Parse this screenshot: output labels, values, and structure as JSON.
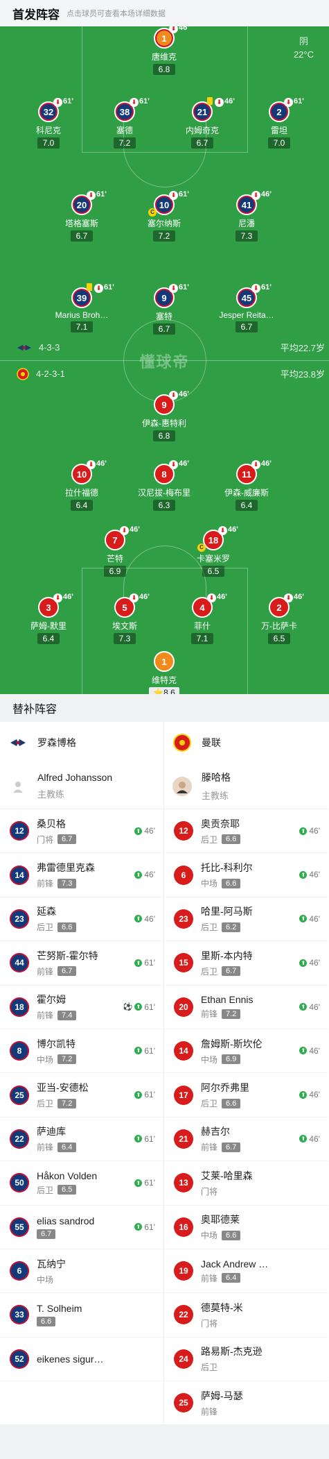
{
  "header": {
    "title": "首发阵容",
    "subtitle": "点击球员可查看本场详细数据"
  },
  "weather": {
    "condition": "阴",
    "temperature": "22°C"
  },
  "watermark": "懂球帝",
  "away_team": {
    "formation": "4-3-3",
    "avg_age": "平均22.7岁"
  },
  "home_team": {
    "formation": "4-2-3-1",
    "avg_age": "平均23.8岁"
  },
  "away_lineup": [
    {
      "num": "1",
      "name": "唐维克",
      "rating": "6.8",
      "sub_min": "46'",
      "gk": true
    },
    {
      "num": "32",
      "name": "科尼克",
      "rating": "7.0",
      "sub_min": "61'"
    },
    {
      "num": "38",
      "name": "塞德",
      "rating": "7.2",
      "sub_min": "61'"
    },
    {
      "num": "21",
      "name": "内姆奇克",
      "rating": "6.7",
      "sub_min": "46'",
      "yellow": true
    },
    {
      "num": "2",
      "name": "雷坦",
      "rating": "7.0",
      "sub_min": "61'"
    },
    {
      "num": "20",
      "name": "塔格塞斯",
      "rating": "6.7",
      "sub_min": "61'"
    },
    {
      "num": "10",
      "name": "塞尔纳斯",
      "rating": "7.2",
      "sub_min": "61'",
      "captain": true
    },
    {
      "num": "41",
      "name": "尼潘",
      "rating": "7.3",
      "sub_min": "46'"
    },
    {
      "num": "39",
      "name": "Marius Broh…",
      "rating": "7.1",
      "sub_min": "61'",
      "yellow": true
    },
    {
      "num": "9",
      "name": "塞特",
      "rating": "6.7",
      "sub_min": "61'"
    },
    {
      "num": "45",
      "name": "Jesper Reita…",
      "rating": "6.7",
      "sub_min": "61'"
    }
  ],
  "home_lineup": [
    {
      "num": "9",
      "name": "伊森-惠特利",
      "rating": "6.8",
      "sub_min": "46'"
    },
    {
      "num": "10",
      "name": "拉什福德",
      "rating": "6.4",
      "sub_min": "46'"
    },
    {
      "num": "8",
      "name": "汉尼拔-梅布里",
      "rating": "6.3",
      "sub_min": "46'"
    },
    {
      "num": "11",
      "name": "伊森-威廉斯",
      "rating": "6.4",
      "sub_min": "46'"
    },
    {
      "num": "7",
      "name": "芒特",
      "rating": "6.9",
      "sub_min": "46'"
    },
    {
      "num": "18",
      "name": "卡塞米罗",
      "rating": "6.5",
      "sub_min": "46'",
      "captain": true
    },
    {
      "num": "3",
      "name": "萨姆-默里",
      "rating": "6.4",
      "sub_min": "46'"
    },
    {
      "num": "5",
      "name": "埃文斯",
      "rating": "7.3",
      "sub_min": "46'"
    },
    {
      "num": "4",
      "name": "菲什",
      "rating": "7.1",
      "sub_min": "46'"
    },
    {
      "num": "2",
      "name": "万-比萨卡",
      "rating": "6.5",
      "sub_min": "46'"
    },
    {
      "num": "1",
      "name": "维特克",
      "rating": "8.6",
      "star": true,
      "gk": true
    }
  ],
  "subs_title": "替补阵容",
  "left_team": {
    "name": "罗森博格",
    "coach": "Alfred Johansson",
    "coach_role": "主教练",
    "players": [
      {
        "num": "12",
        "name": "桑贝格",
        "pos": "门将",
        "rating": "6.7",
        "in": "46'"
      },
      {
        "num": "14",
        "name": "弗雷德里克森",
        "pos": "前锋",
        "rating": "7.3",
        "in": "46'"
      },
      {
        "num": "23",
        "name": "延森",
        "pos": "后卫",
        "rating": "6.6",
        "in": "46'"
      },
      {
        "num": "44",
        "name": "芒努斯-霍尔特",
        "pos": "前锋",
        "rating": "6.7",
        "in": "61'"
      },
      {
        "num": "18",
        "name": "霍尔姆",
        "pos": "前锋",
        "rating": "7.4",
        "in": "61'",
        "goal": true
      },
      {
        "num": "8",
        "name": "博尔凯特",
        "pos": "中场",
        "rating": "7.2",
        "in": "61'"
      },
      {
        "num": "25",
        "name": "亚当-安德松",
        "pos": "后卫",
        "rating": "7.2",
        "in": "61'"
      },
      {
        "num": "22",
        "name": "萨迪库",
        "pos": "前锋",
        "rating": "6.4",
        "in": "61'"
      },
      {
        "num": "50",
        "name": "Håkon Volden",
        "pos": "后卫",
        "rating": "6.5",
        "in": "61'"
      },
      {
        "num": "55",
        "name": "elias sandrod",
        "pos": "",
        "rating": "6.7",
        "in": "61'"
      },
      {
        "num": "6",
        "name": "瓦纳宁",
        "pos": "中场",
        "rating": "",
        "in": ""
      },
      {
        "num": "33",
        "name": "T. Solheim",
        "pos": "",
        "rating": "6.6",
        "in": ""
      },
      {
        "num": "52",
        "name": "eikenes sigur…",
        "pos": "",
        "rating": "",
        "in": ""
      }
    ]
  },
  "right_team": {
    "name": "曼联",
    "coach": "滕哈格",
    "coach_role": "主教练",
    "players": [
      {
        "num": "12",
        "name": "奥贡奈耶",
        "pos": "后卫",
        "rating": "6.6",
        "in": "46'"
      },
      {
        "num": "6",
        "name": "托比-科利尔",
        "pos": "中场",
        "rating": "6.6",
        "in": "46'"
      },
      {
        "num": "23",
        "name": "哈里-阿马斯",
        "pos": "后卫",
        "rating": "6.2",
        "in": "46'"
      },
      {
        "num": "15",
        "name": "里斯-本内特",
        "pos": "后卫",
        "rating": "6.7",
        "in": "46'"
      },
      {
        "num": "20",
        "name": "Ethan Ennis",
        "pos": "前锋",
        "rating": "7.2",
        "in": "46'"
      },
      {
        "num": "14",
        "name": "詹姆斯-斯坎伦",
        "pos": "中场",
        "rating": "6.9",
        "in": "46'"
      },
      {
        "num": "17",
        "name": "阿尔乔弗里",
        "pos": "后卫",
        "rating": "6.6",
        "in": "46'"
      },
      {
        "num": "21",
        "name": "赫吉尔",
        "pos": "前锋",
        "rating": "6.7",
        "in": "46'"
      },
      {
        "num": "13",
        "name": "艾莱-哈里森",
        "pos": "门将",
        "rating": "",
        "in": ""
      },
      {
        "num": "16",
        "name": "奥耶德莱",
        "pos": "中场",
        "rating": "6.6",
        "in": ""
      },
      {
        "num": "19",
        "name": "Jack Andrew …",
        "pos": "前锋",
        "rating": "6.4",
        "in": ""
      },
      {
        "num": "22",
        "name": "德莫特-米",
        "pos": "门将",
        "rating": "",
        "in": ""
      },
      {
        "num": "24",
        "name": "路易斯-杰克逊",
        "pos": "后卫",
        "rating": "",
        "in": ""
      },
      {
        "num": "25",
        "name": "萨姆-马瑟",
        "pos": "前锋",
        "rating": "",
        "in": ""
      }
    ]
  }
}
